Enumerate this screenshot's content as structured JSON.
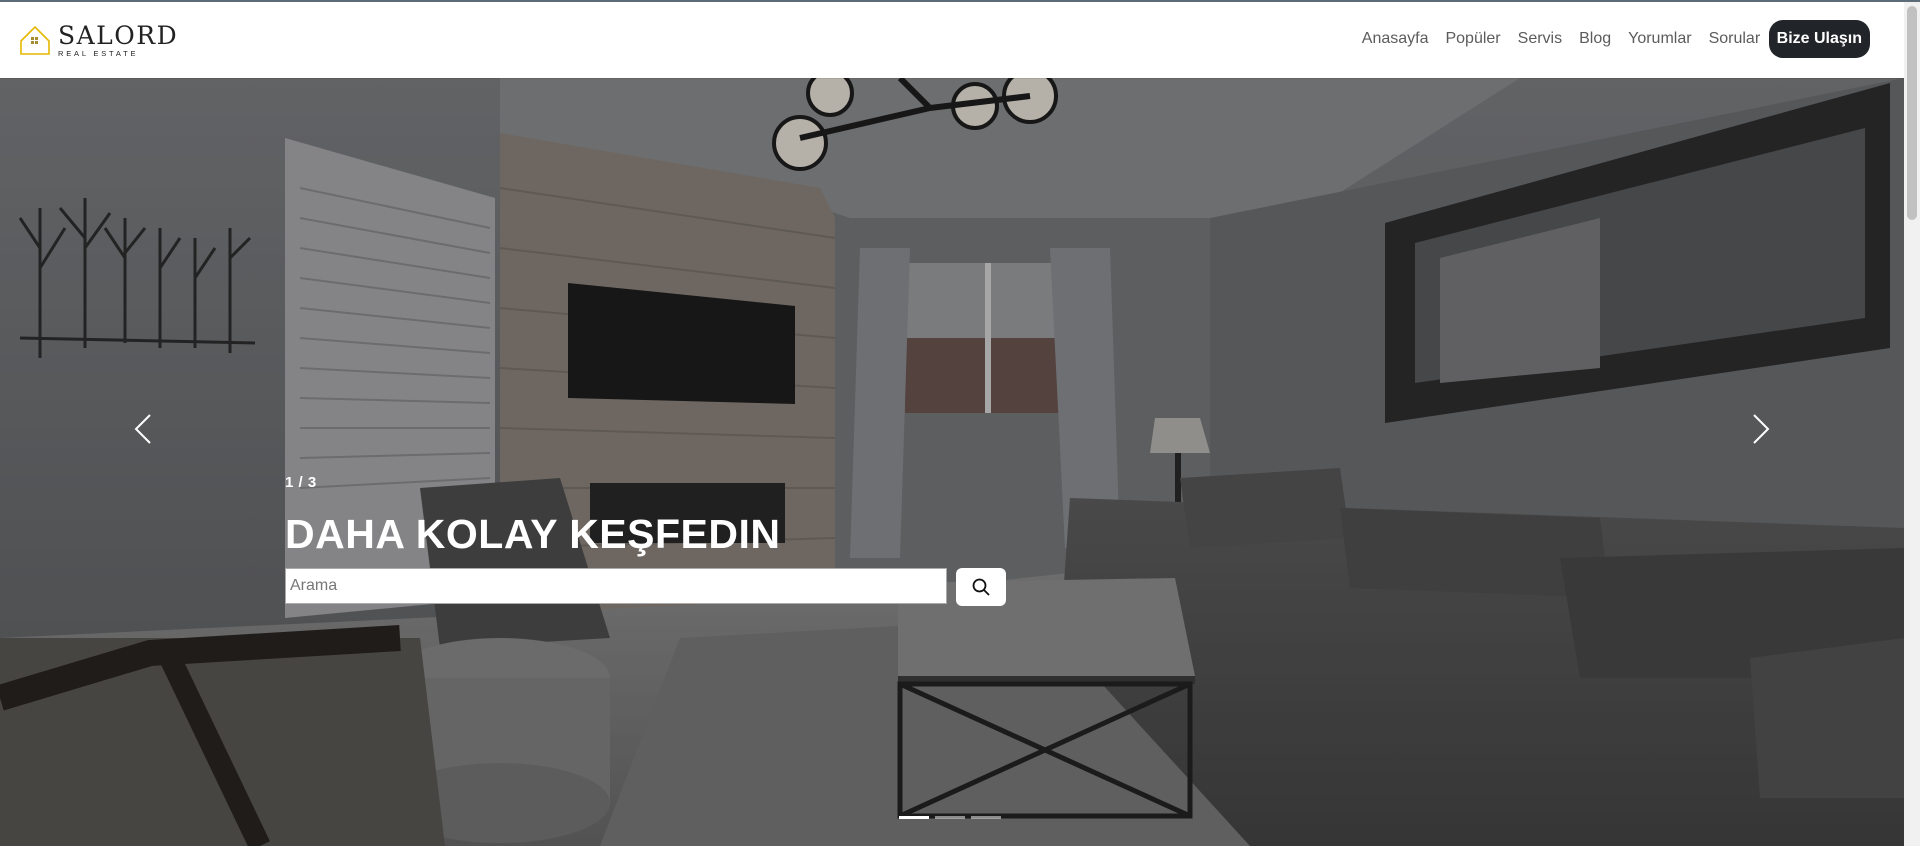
{
  "brand": {
    "name": "SALORD",
    "tagline": "REAL ESTATE",
    "accent": "#e6b800"
  },
  "nav": {
    "links": [
      "Anasayfa",
      "Popüler",
      "Servis",
      "Blog",
      "Yorumlar",
      "Sorular"
    ],
    "cta": "Bize Ulaşın"
  },
  "hero": {
    "slide_counter": "1 / 3",
    "title": "DAHA KOLAY KEŞFEDIN",
    "search_placeholder": "Arama",
    "search_value": "",
    "active_slide": 1,
    "total_slides": 3,
    "overlay_color": "#000000"
  },
  "icons": {
    "search": "search-icon",
    "prev": "chevron-left-icon",
    "next": "chevron-right-icon",
    "logo": "house-logo-icon"
  }
}
